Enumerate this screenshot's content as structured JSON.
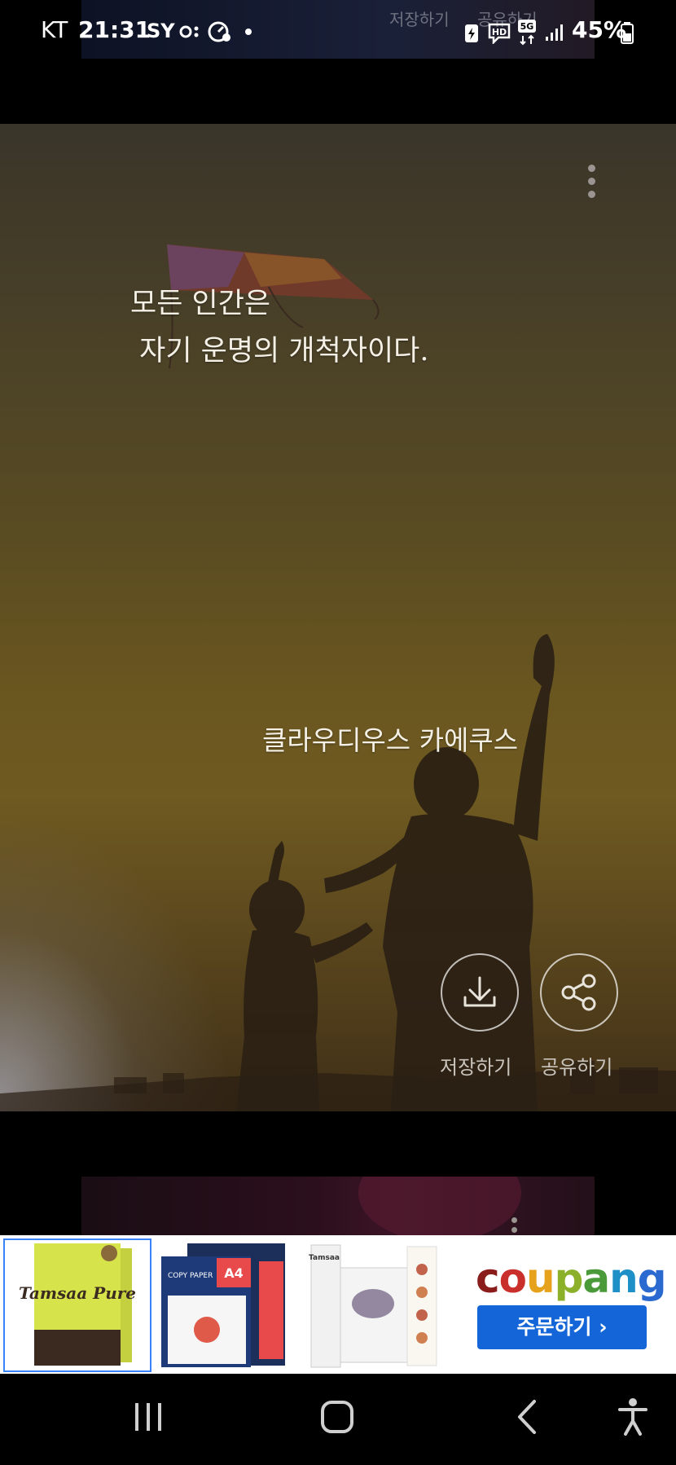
{
  "status_bar": {
    "carrier": "KT",
    "time": "21:31",
    "indicator": "SY",
    "battery": "45%"
  },
  "top_card": {
    "save_label": "저장하기",
    "share_label": "공유하기"
  },
  "quote_card": {
    "quote": "모든 인간은\n 자기 운명의 개척자이다.",
    "author": "클라우디우스 카에쿠스",
    "save_label": "저장하기",
    "share_label": "공유하기"
  },
  "ad": {
    "product1_text": "Tamsaa Pure",
    "product2_text": "COPY PAPER",
    "product2_size": "A4",
    "product3_text": "Tamsaa",
    "logo_letters": [
      "c",
      "o",
      "u",
      "p",
      "a",
      "n",
      "g"
    ],
    "logo_colors": [
      "#8a1c1c",
      "#c9302c",
      "#e5a21a",
      "#8cb02a",
      "#4a9a3a",
      "#1f8fc8",
      "#2a6ad0"
    ],
    "order_label": "주문하기 ›",
    "button_color": "#1466d8"
  },
  "icons": [
    "download-icon",
    "share-icon",
    "recent-apps-icon",
    "home-icon",
    "back-icon",
    "accessibility-icon",
    "kebab-menu-icon"
  ]
}
